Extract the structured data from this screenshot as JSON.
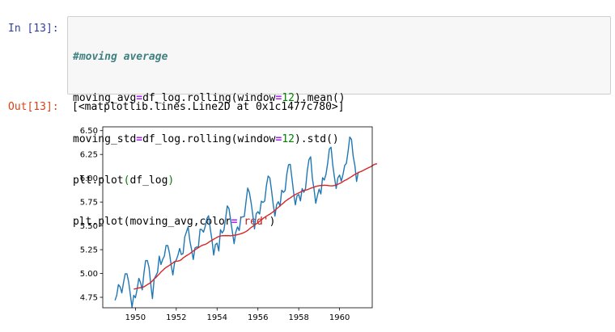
{
  "cell": {
    "in_prompt": "In [13]:",
    "out_prompt": "Out[13]:",
    "code": {
      "comment": "#moving average",
      "line2": {
        "a": "moving_avg",
        "op": "=",
        "b": "df_log.rolling(window",
        "op2": "=",
        "num": "12",
        "c": ").mean()"
      },
      "line3": {
        "a": "moving_std",
        "op": "=",
        "b": "df_log.rolling(window",
        "op2": "=",
        "num": "12",
        "c": ").std()"
      },
      "line4": {
        "a": "plt.plot",
        "p1": "(",
        "b": "df_log",
        "p2": ")"
      },
      "line5": {
        "a": "plt.plot(moving_avg,color",
        "op": "=",
        "str": "'red'",
        "c": ")"
      }
    },
    "output_text": "[<matplotlib.lines.Line2D at 0x1c1477c780>]"
  },
  "chart_data": {
    "type": "line",
    "x_ticks": [
      1950,
      1952,
      1954,
      1956,
      1958,
      1960
    ],
    "y_ticks": [
      4.75,
      5.0,
      5.25,
      5.5,
      5.75,
      6.0,
      6.25,
      6.5
    ],
    "y_tick_labels": [
      "4.75",
      "5.00",
      "5.25",
      "5.50",
      "5.75",
      "6.00",
      "6.25",
      "6.50"
    ],
    "x_tick_labels": [
      "1950",
      "1952",
      "1954",
      "1956",
      "1958",
      "1960"
    ],
    "xlim": [
      1948.4,
      1961.6
    ],
    "ylim": [
      4.64,
      6.54
    ],
    "grid": false,
    "series": [
      {
        "color": "#1f77b4",
        "x_start": 1949.0,
        "x_step": 0.0833333,
        "values": [
          4.718,
          4.771,
          4.883,
          4.86,
          4.796,
          4.905,
          4.997,
          4.997,
          4.913,
          4.779,
          4.644,
          4.771,
          4.745,
          4.836,
          4.949,
          4.905,
          4.828,
          5.004,
          5.136,
          5.136,
          5.063,
          4.89,
          4.736,
          4.942,
          4.977,
          5.011,
          5.182,
          5.094,
          5.147,
          5.182,
          5.293,
          5.293,
          5.215,
          5.088,
          4.984,
          5.112,
          5.142,
          5.193,
          5.263,
          5.199,
          5.209,
          5.384,
          5.438,
          5.489,
          5.342,
          5.252,
          5.147,
          5.268,
          5.278,
          5.278,
          5.464,
          5.46,
          5.434,
          5.493,
          5.576,
          5.606,
          5.468,
          5.352,
          5.193,
          5.303,
          5.318,
          5.236,
          5.46,
          5.425,
          5.455,
          5.576,
          5.71,
          5.68,
          5.557,
          5.434,
          5.313,
          5.434,
          5.489,
          5.451,
          5.587,
          5.595,
          5.598,
          5.753,
          5.897,
          5.849,
          5.743,
          5.613,
          5.468,
          5.628,
          5.649,
          5.624,
          5.759,
          5.746,
          5.762,
          5.924,
          6.023,
          6.004,
          5.872,
          5.724,
          5.602,
          5.724,
          5.753,
          5.707,
          5.875,
          5.852,
          5.872,
          6.045,
          6.142,
          6.146,
          6.001,
          5.849,
          5.72,
          5.817,
          5.829,
          5.762,
          5.892,
          5.852,
          5.894,
          6.075,
          6.196,
          6.225,
          6.001,
          5.883,
          5.737,
          5.82,
          5.886,
          5.835,
          6.006,
          5.981,
          6.04,
          6.157,
          6.306,
          6.326,
          6.138,
          6.009,
          5.892,
          6.004,
          6.033,
          5.969,
          6.038,
          6.133,
          6.157,
          6.282,
          6.433,
          6.407,
          6.23,
          6.133,
          5.966,
          6.068
        ]
      },
      {
        "color": "#d62728",
        "x_start": 1949.9167,
        "x_step": 0.0833333,
        "values": [
          4.837,
          4.839,
          4.844,
          4.848,
          4.851,
          4.853,
          4.86,
          4.871,
          4.883,
          4.894,
          4.905,
          4.923,
          4.942,
          4.957,
          4.977,
          4.994,
          5.016,
          5.031,
          5.049,
          5.064,
          5.074,
          5.086,
          5.098,
          5.11,
          5.125,
          5.128,
          5.13,
          5.135,
          5.146,
          5.163,
          5.175,
          5.187,
          5.198,
          5.209,
          5.223,
          5.237,
          5.248,
          5.26,
          5.271,
          5.283,
          5.294,
          5.3,
          5.305,
          5.314,
          5.327,
          5.339,
          5.348,
          5.36,
          5.37,
          5.38,
          5.389,
          5.393,
          5.397,
          5.398,
          5.397,
          5.397,
          5.398,
          5.396,
          5.399,
          5.402,
          5.403,
          5.408,
          5.412,
          5.418,
          5.424,
          5.431,
          5.441,
          5.452,
          5.468,
          5.483,
          5.495,
          5.508,
          5.521,
          5.534,
          5.548,
          5.561,
          5.577,
          5.59,
          5.602,
          5.613,
          5.623,
          5.635,
          5.649,
          5.663,
          5.679,
          5.694,
          5.71,
          5.726,
          5.74,
          5.757,
          5.77,
          5.783,
          5.793,
          5.807,
          5.818,
          5.829,
          5.838,
          5.846,
          5.855,
          5.865,
          5.872,
          5.875,
          5.88,
          5.887,
          5.895,
          5.901,
          5.906,
          5.914,
          5.918,
          5.921,
          5.924,
          5.924,
          5.927,
          5.926,
          5.924,
          5.921,
          5.92,
          5.92,
          5.924,
          5.93,
          5.937,
          5.945,
          5.953,
          5.965,
          5.977,
          5.984,
          5.995,
          6.006,
          6.017,
          6.029,
          6.04,
          6.05,
          6.058,
          6.067,
          6.074,
          6.083,
          6.093,
          6.101,
          6.111,
          6.118,
          6.129,
          6.141,
          6.148,
          6.152
        ]
      }
    ]
  }
}
